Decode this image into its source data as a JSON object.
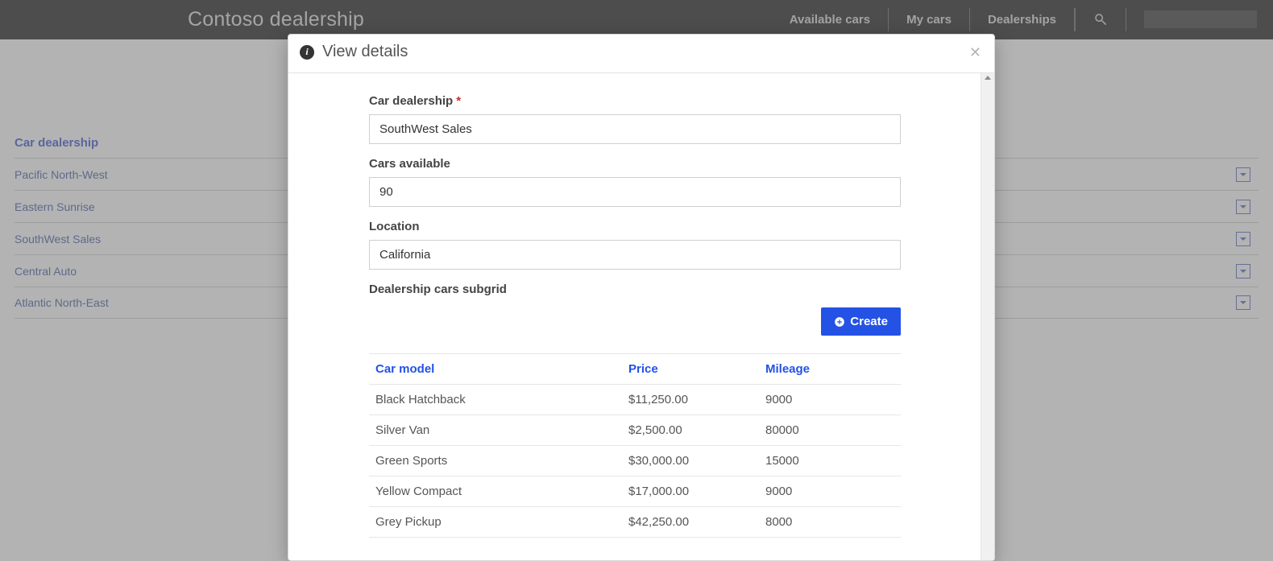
{
  "topbar": {
    "brand": "Contoso dealership",
    "nav": {
      "available": "Available cars",
      "mycars": "My cars",
      "dealerships": "Dealerships"
    }
  },
  "bg": {
    "header": "Car dealership",
    "rows": [
      "Pacific North-West",
      "Eastern Sunrise",
      "SouthWest Sales",
      "Central Auto",
      "Atlantic North-East"
    ]
  },
  "modal": {
    "title": "View details",
    "labels": {
      "dealership": "Car dealership",
      "cars_available": "Cars available",
      "location": "Location",
      "subgrid": "Dealership cars subgrid"
    },
    "values": {
      "dealership": "SouthWest Sales",
      "cars_available": "90",
      "location": "California"
    },
    "create_btn": "Create",
    "columns": {
      "model": "Car model",
      "price": "Price",
      "mileage": "Mileage"
    },
    "cars": [
      {
        "model": "Black Hatchback",
        "price": "$11,250.00",
        "mileage": "9000"
      },
      {
        "model": "Silver Van",
        "price": "$2,500.00",
        "mileage": "80000"
      },
      {
        "model": "Green Sports",
        "price": "$30,000.00",
        "mileage": "15000"
      },
      {
        "model": "Yellow Compact",
        "price": "$17,000.00",
        "mileage": "9000"
      },
      {
        "model": "Grey Pickup",
        "price": "$42,250.00",
        "mileage": "8000"
      }
    ]
  }
}
